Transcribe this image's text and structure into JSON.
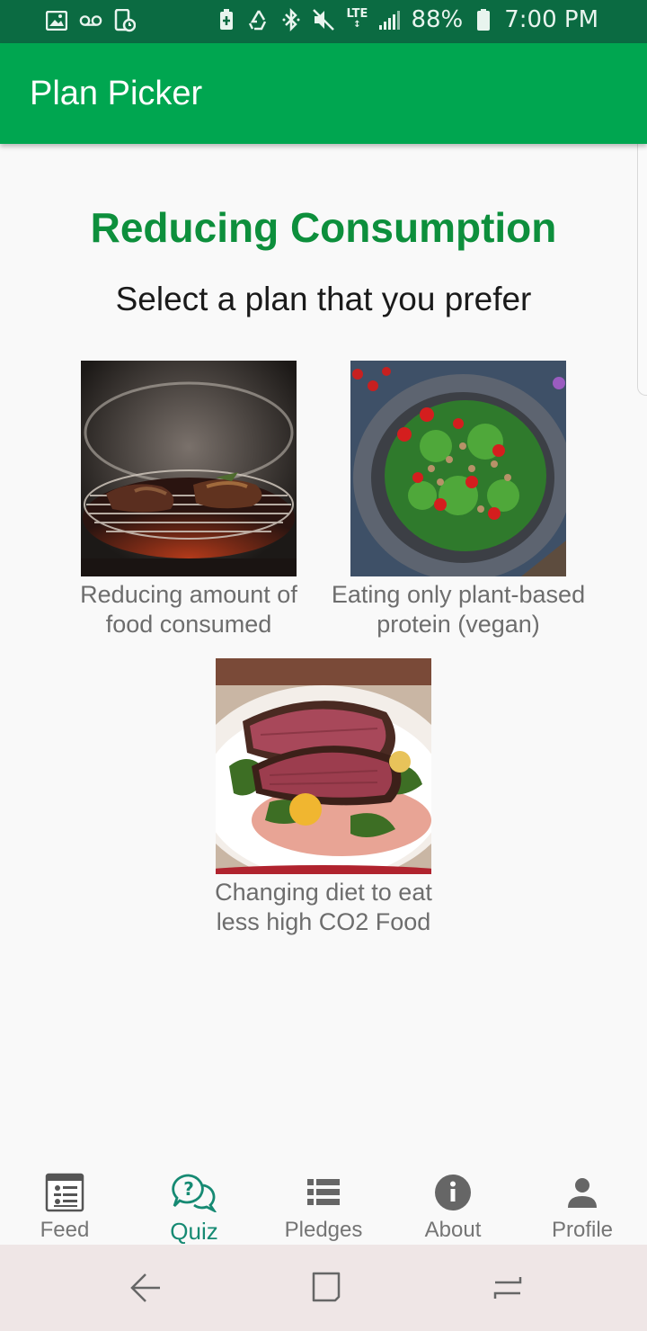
{
  "status_bar": {
    "battery_percent": "88%",
    "time": "7:00 PM",
    "network": "LTE",
    "left_icons": [
      "image-icon",
      "voicemail-icon",
      "phone-clock-icon"
    ],
    "right_icons": [
      "battery-saver-icon",
      "recycle-icon",
      "bluetooth-icon",
      "mute-icon",
      "lte-icon",
      "signal-icon",
      "battery-icon"
    ]
  },
  "app_bar": {
    "title": "Plan Picker"
  },
  "main": {
    "heading": "Reducing Consumption",
    "subheading": "Select a plan that you prefer",
    "plans": [
      {
        "line1": "Reducing amount of",
        "line2": "food consumed",
        "image": "grilled-meat-photo"
      },
      {
        "line1": "Eating only plant-based",
        "line2": "protein (vegan)",
        "image": "salad-bowl-photo"
      },
      {
        "line1": "Changing diet to eat",
        "line2": "less high CO2 Food",
        "image": "steak-plate-photo"
      }
    ]
  },
  "bottom_nav": {
    "active": "Quiz",
    "items": [
      {
        "label": "Feed",
        "icon": "feed-icon"
      },
      {
        "label": "Quiz",
        "icon": "quiz-icon"
      },
      {
        "label": "Pledges",
        "icon": "list-icon"
      },
      {
        "label": "About",
        "icon": "info-icon"
      },
      {
        "label": "Profile",
        "icon": "person-icon"
      }
    ]
  },
  "system_nav": {
    "buttons": [
      "back-icon",
      "home-icon",
      "recents-icon"
    ]
  },
  "colors": {
    "status_bar": "#0b6b42",
    "app_bar": "#00a650",
    "heading": "#0d8f3c",
    "nav_active": "#168a73",
    "nav_inactive": "#757575"
  }
}
